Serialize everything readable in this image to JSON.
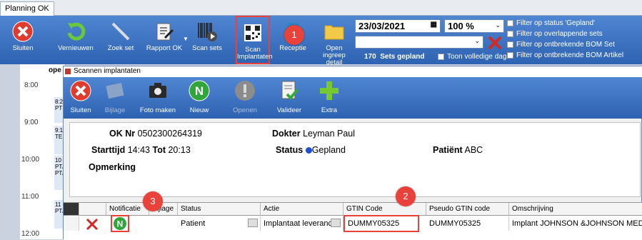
{
  "window": {
    "tab": "Planning OK"
  },
  "toolbar": {
    "sluiten": "Sluiten",
    "vernieuwen": "Vernieuwen",
    "zoek_set": "Zoek set",
    "rapport_ok": "Rapport OK",
    "scan_sets": "Scan sets",
    "scan_implantaten": "Scan Implantaten",
    "receptie": "Receptie",
    "open_ingreep": "Open ingreep detail",
    "date": "23/03/2021",
    "zoom": "100 %",
    "sets_count": "170",
    "sets_label": "Sets gepland",
    "toon_volledige_dag": "Toon volledige dag"
  },
  "filters": [
    "Filter op status 'Gepland'",
    "Filter op overlappende sets",
    "Filter op ontbrekende BOM Set",
    "Filter op ontbrekende BOM Artikel"
  ],
  "calendar": {
    "header": "ope",
    "hours": [
      "8:00",
      "9:00",
      "10:00",
      "11:00",
      "12:00"
    ],
    "items": [
      "8:2",
      "PT",
      "9:1",
      "TE",
      "10",
      "PT/",
      "PT/",
      "11",
      "PT/"
    ]
  },
  "dialog": {
    "title": "Scannen implantaten",
    "buttons": {
      "sluiten": "Sluiten",
      "bijlage": "Bijlage",
      "foto_maken": "Foto maken",
      "nieuw": "Nieuw",
      "openen": "Openen",
      "valideer": "Valideer",
      "extra": "Extra"
    },
    "info": {
      "ok_nr_label": "OK Nr",
      "ok_nr": "0502300264319",
      "dokter_label": "Dokter",
      "dokter": "Leyman Paul",
      "starttijd_label": "Starttijd",
      "starttijd": "14:43",
      "tot_label": "Tot",
      "tot": "20:13",
      "status_label": "Status",
      "status": "Gepland",
      "patient_label": "Patiënt",
      "patient": "ABC",
      "opmerking_label": "Opmerking"
    },
    "grid": {
      "columns": [
        "Notificatie",
        "Bijlage",
        "Status",
        "Actie",
        "GTIN Code",
        "Pseudo GTIN code",
        "Omschrijving"
      ],
      "row": {
        "notificatie": "N",
        "status": "Patient",
        "actie": "Implantaat leveranc",
        "gtin": "DUMMY05325",
        "pseudo_gtin": "DUMMY05325",
        "omschrijving": "Implant JOHNSON &JOHNSON MEDIC"
      }
    }
  },
  "markers": [
    "1",
    "2",
    "3"
  ],
  "colors": {
    "ribbon": "#3a72c4",
    "marker": "#e8423a",
    "status_dot": "#1f4fd1"
  }
}
